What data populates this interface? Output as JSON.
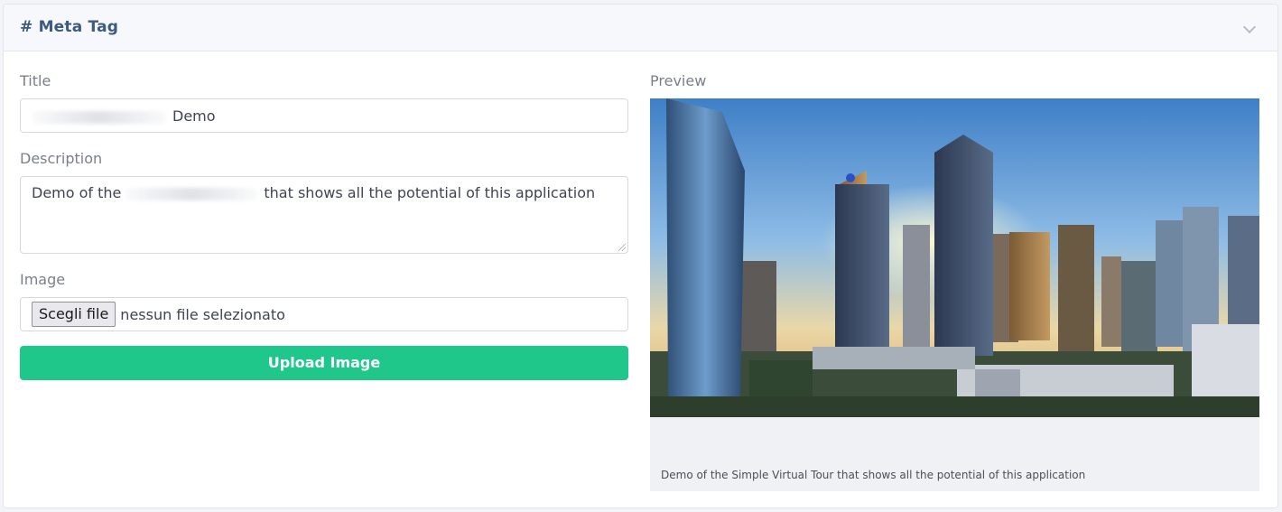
{
  "header": {
    "title": "# Meta Tag",
    "collapse_icon": "chevron-down-icon"
  },
  "form": {
    "title_label": "Title",
    "title_value_visible": "Demo",
    "description_label": "Description",
    "description_prefix": "Demo of the",
    "description_suffix": "that shows all the potential of this application",
    "image_label": "Image",
    "file_button_label": "Scegli file",
    "file_status": "nessun file selezionato",
    "upload_button_label": "Upload Image"
  },
  "preview": {
    "label": "Preview",
    "caption": "Demo of the Simple Virtual Tour that shows all the potential of this application"
  },
  "colors": {
    "accent": "#1fc88a",
    "header_title": "#3d5a80"
  }
}
